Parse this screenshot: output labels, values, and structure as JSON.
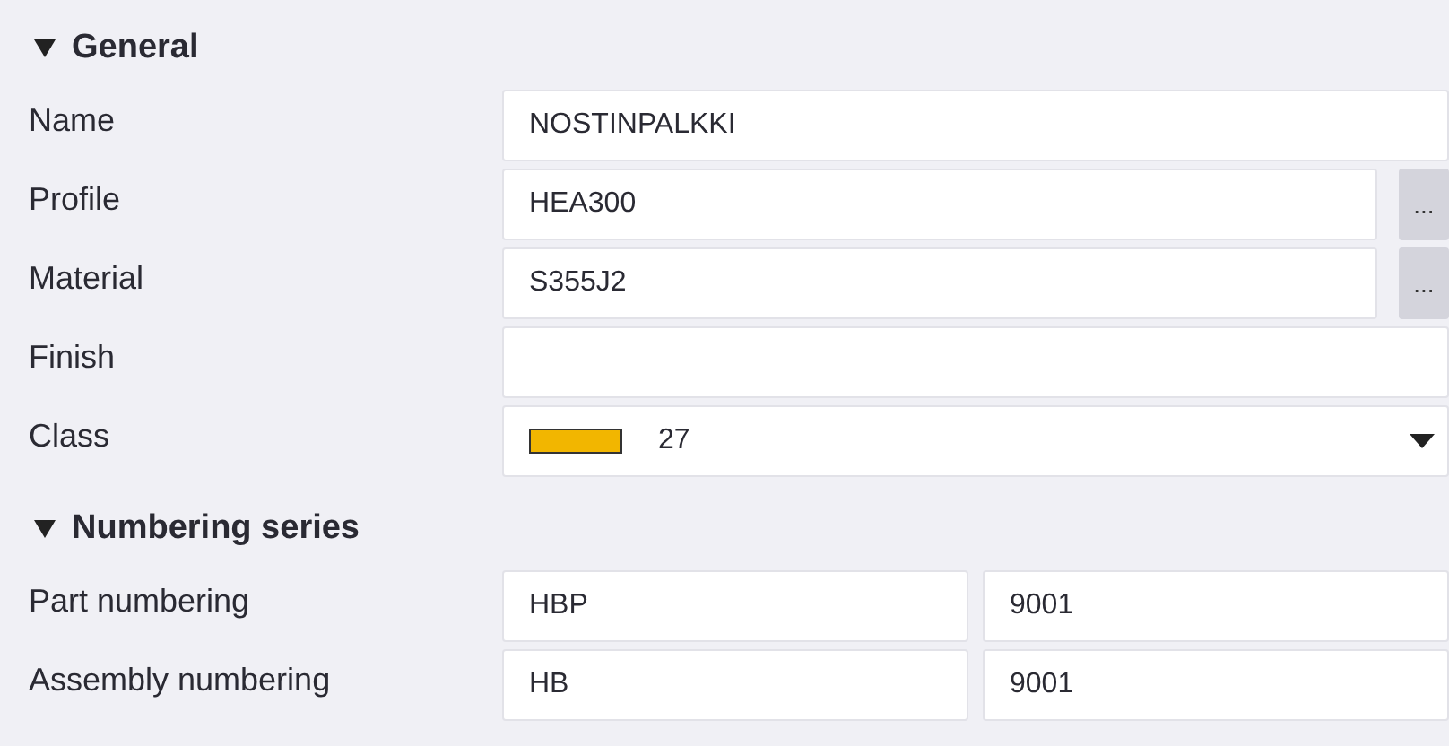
{
  "sections": [
    {
      "title": "General",
      "expanded": true,
      "rows": [
        {
          "kind": "text",
          "label": "Name",
          "value": "NOSTINPALKKI"
        },
        {
          "kind": "browse",
          "label": "Profile",
          "value": "HEA300",
          "button": "..."
        },
        {
          "kind": "browse",
          "label": "Material",
          "value": "S355J2",
          "button": "..."
        },
        {
          "kind": "text",
          "label": "Finish"
        },
        {
          "kind": "color",
          "label": "Class",
          "value": "27",
          "color": "#f2b600"
        }
      ]
    },
    {
      "title": "Numbering series",
      "expanded": true,
      "rows": [
        {
          "kind": "pair",
          "label": "Part numbering",
          "values": [
            "HBP",
            "9001"
          ]
        },
        {
          "kind": "pair",
          "label": "Assembly numbering",
          "values": [
            "HB",
            "9001"
          ]
        }
      ]
    }
  ]
}
